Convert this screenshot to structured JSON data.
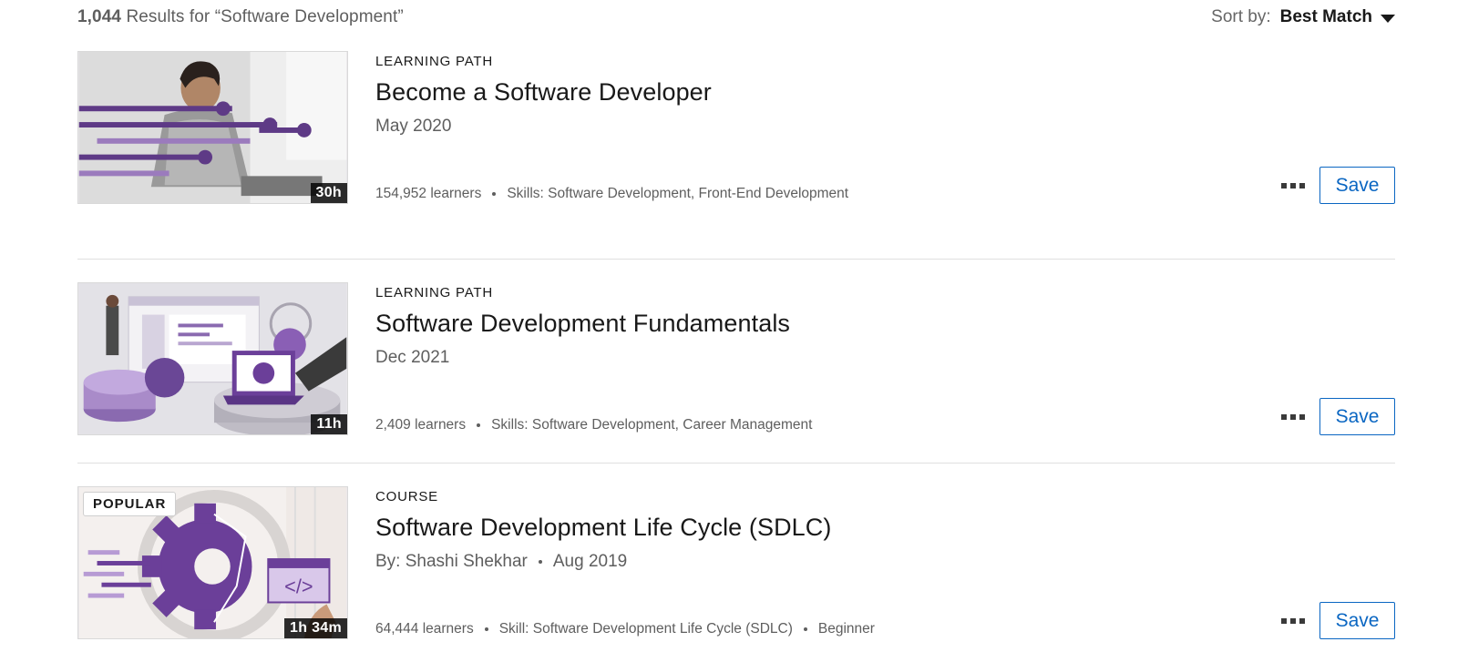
{
  "results": {
    "count": "1,044",
    "text": "Results for “Software Development”"
  },
  "sort": {
    "label": "Sort by:",
    "value": "Best Match"
  },
  "items": [
    {
      "type": "LEARNING PATH",
      "title": "Become a Software Developer",
      "date": "May 2020",
      "duration": "30h",
      "learners": "154,952 learners",
      "skills": "Skills: Software Development, Front-End Development",
      "save_label": "Save"
    },
    {
      "type": "LEARNING PATH",
      "title": "Software Development Fundamentals",
      "date": "Dec 2021",
      "duration": "11h",
      "learners": "2,409 learners",
      "skills": "Skills: Software Development, Career Management",
      "save_label": "Save"
    },
    {
      "type": "COURSE",
      "title": "Software Development Life Cycle (SDLC)",
      "author": "By: Shashi Shekhar",
      "date": "Aug 2019",
      "duration": "1h 34m",
      "badge": "POPULAR",
      "learners": "64,444 learners",
      "skills": "Skill: Software Development Life Cycle (SDLC)",
      "level": "Beginner",
      "save_label": "Save"
    }
  ],
  "icons": {
    "more": "more-options-icon",
    "caret": "caret-down-icon"
  },
  "colors": {
    "accent": "#0a66c2",
    "purple": "#6b3f99",
    "text": "#191919",
    "muted": "#5e5e5e"
  }
}
